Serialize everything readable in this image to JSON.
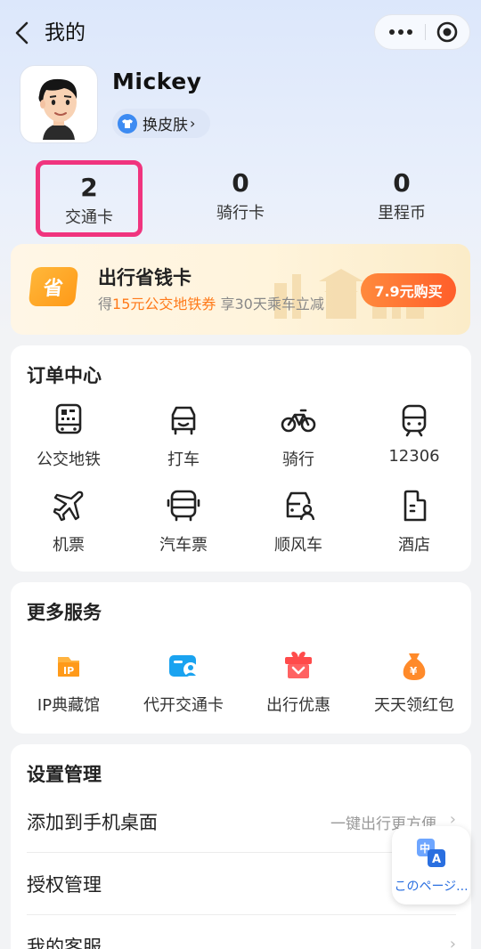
{
  "nav": {
    "title": "我的",
    "more_icon": "ellipsis-icon",
    "close_icon": "target-circle-icon"
  },
  "profile": {
    "username": "Mickey",
    "skin_label": "换皮肤",
    "skin_chevron": "›",
    "avatar_icon": "cartoon-avatar-icon"
  },
  "stats": [
    {
      "value": "2",
      "label": "交通卡",
      "highlighted": true
    },
    {
      "value": "0",
      "label": "骑行卡",
      "highlighted": false
    },
    {
      "value": "0",
      "label": "里程币",
      "highlighted": false
    }
  ],
  "promo": {
    "badge": "省",
    "title": "出行省钱卡",
    "sub_prefix": "得",
    "sub_highlight": "15元公交地铁券",
    "sub_suffix": "享30天乘车立减",
    "button": "7.9元购买",
    "accent_color": "#ff7a1a"
  },
  "orders": {
    "title": "订单中心",
    "items": [
      {
        "label": "公交地铁",
        "icon": "bus-card-icon"
      },
      {
        "label": "打车",
        "icon": "car-icon"
      },
      {
        "label": "骑行",
        "icon": "bicycle-icon"
      },
      {
        "label": "12306",
        "icon": "train-icon"
      },
      {
        "label": "机票",
        "icon": "airplane-icon"
      },
      {
        "label": "汽车票",
        "icon": "coach-icon"
      },
      {
        "label": "顺风车",
        "icon": "carpool-icon"
      },
      {
        "label": "酒店",
        "icon": "hotel-icon"
      }
    ]
  },
  "services": {
    "title": "更多服务",
    "items": [
      {
        "label": "IP典藏馆",
        "icon": "ip-collection-icon"
      },
      {
        "label": "代开交通卡",
        "icon": "issue-card-icon"
      },
      {
        "label": "出行优惠",
        "icon": "gift-icon"
      },
      {
        "label": "天天领红包",
        "icon": "money-bag-icon"
      }
    ]
  },
  "settings": {
    "title": "设置管理",
    "rows": [
      {
        "label": "添加到手机桌面",
        "hint": "一键出行更方便",
        "chevron": "›"
      },
      {
        "label": "授权管理",
        "hint": "",
        "chevron": "›"
      },
      {
        "label": "我的客服",
        "hint": "",
        "chevron": "›"
      }
    ]
  },
  "translate": {
    "label": "このページ...",
    "icon": "translate-icon"
  }
}
